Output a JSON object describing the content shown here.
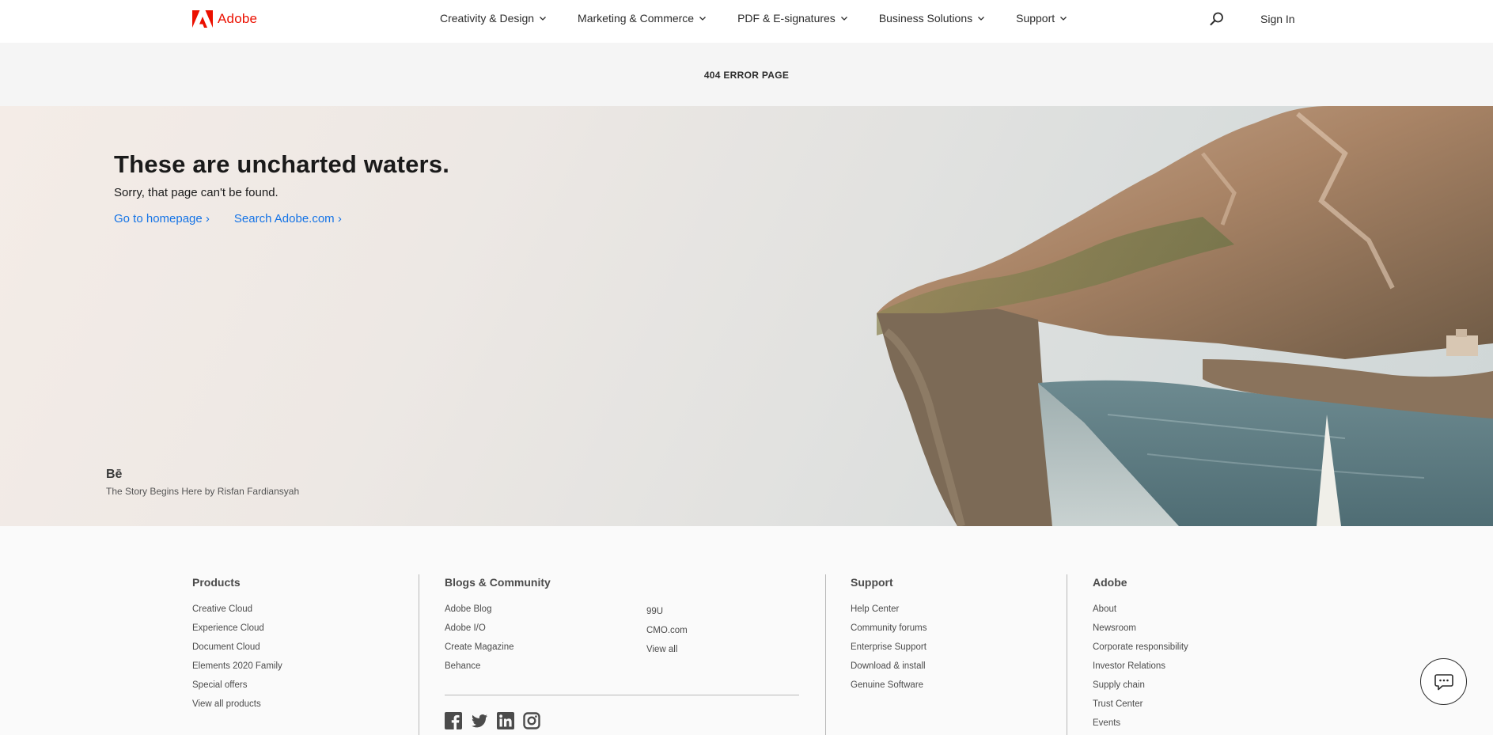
{
  "header": {
    "brand": "Adobe",
    "brand_color": "#eb1000",
    "nav": [
      {
        "label": "Creativity & Design"
      },
      {
        "label": "Marketing & Commerce"
      },
      {
        "label": "PDF & E-signatures"
      },
      {
        "label": "Business Solutions"
      },
      {
        "label": "Support"
      }
    ],
    "search_icon": "search-icon",
    "signin_label": "Sign In"
  },
  "page_strip": {
    "title": "404 ERROR PAGE"
  },
  "hero": {
    "title": "These are uncharted waters.",
    "subtitle": "Sorry, that page can't be found.",
    "links": [
      {
        "label": "Go to homepage ›"
      },
      {
        "label": "Search Adobe.com ›"
      }
    ],
    "link_color": "#1473e6",
    "credit_icon": "Bē",
    "credit": "The Story Begins Here by Risfan Fardiansyah"
  },
  "footer": {
    "products": {
      "title": "Products",
      "items": [
        "Creative Cloud",
        "Experience Cloud",
        "Document Cloud",
        "Elements 2020 Family",
        "Special offers",
        "View all products"
      ]
    },
    "blogs": {
      "title": "Blogs & Community",
      "items_left": [
        "Adobe Blog",
        "Adobe I/O",
        "Create Magazine",
        "Behance"
      ],
      "items_right": [
        "99U",
        "CMO.com",
        "View all"
      ],
      "social_icons": [
        "facebook-icon",
        "twitter-icon",
        "linkedin-icon",
        "instagram-icon"
      ]
    },
    "support": {
      "title": "Support",
      "items": [
        "Help Center",
        "Community forums",
        "Enterprise Support",
        "Download & install",
        "Genuine Software"
      ]
    },
    "adobe": {
      "title": "Adobe",
      "items": [
        "About",
        "Newsroom",
        "Corporate responsibility",
        "Investor Relations",
        "Supply chain",
        "Trust Center",
        "Events"
      ]
    }
  },
  "chat": {
    "icon": "chat-icon"
  }
}
